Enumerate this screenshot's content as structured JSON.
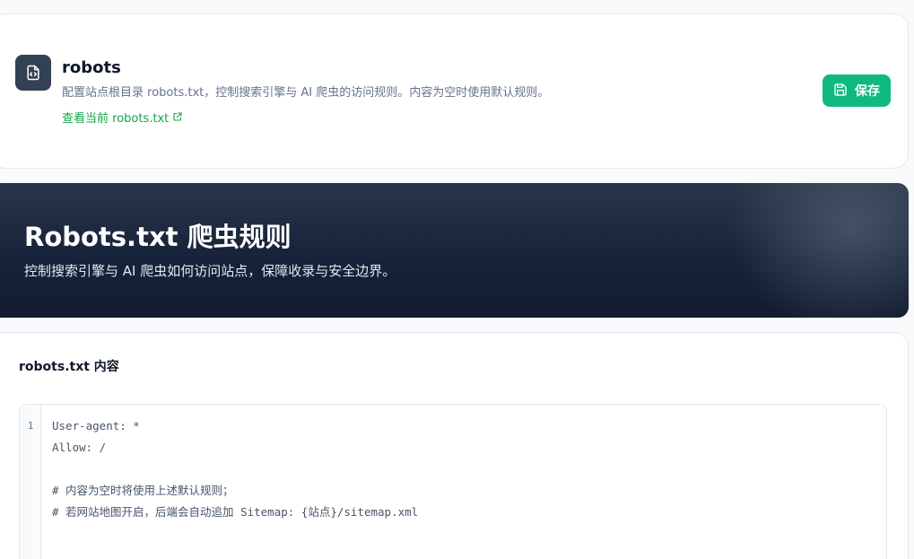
{
  "header": {
    "title": "robots",
    "description": "配置站点根目录 robots.txt，控制搜索引擎与 AI 爬虫的访问规则。内容为空时使用默认规则。",
    "view_link": "查看当前 robots.txt",
    "save_label": "保存",
    "icon": "file-code-icon"
  },
  "hero": {
    "title": "Robots.txt 爬虫规则",
    "subtitle": "控制搜索引擎与 AI 爬虫如何访问站点，保障收录与安全边界。"
  },
  "editor": {
    "section_title": "robots.txt 内容",
    "line_number": "1",
    "lines": [
      "User-agent: *",
      "Allow: /",
      "",
      "# 内容为空时将使用上述默认规则；",
      "# 若网站地图开启，后端会自动追加 Sitemap: {站点}/sitemap.xml"
    ]
  },
  "colors": {
    "accent": "#10b981",
    "link": "#16a34a",
    "icon_bg": "#334155",
    "hero_bg": "#17233a"
  }
}
